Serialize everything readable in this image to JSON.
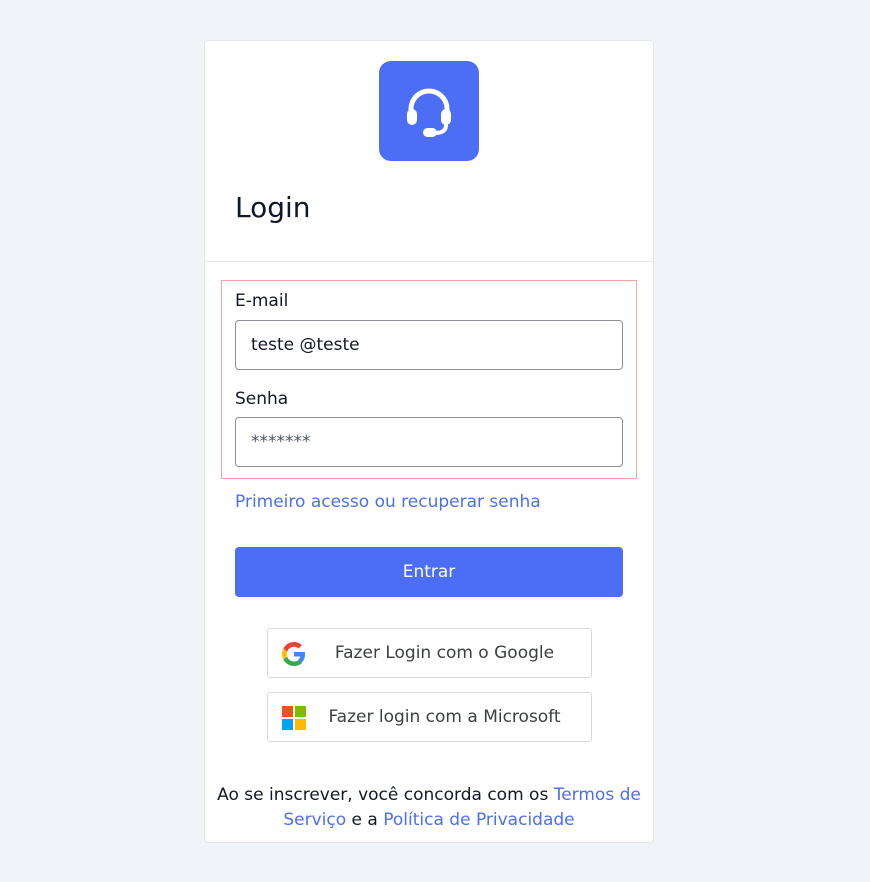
{
  "login": {
    "title": "Login",
    "email_label": "E-mail",
    "email_value": "teste @teste",
    "password_label": "Senha",
    "password_placeholder": "*******",
    "recover_link": "Primeiro acesso ou recuperar senha",
    "submit_label": "Entrar",
    "google_label": "Fazer Login com o Google",
    "microsoft_label": "Fazer login com a Microsoft"
  },
  "terms": {
    "prefix": "Ao se inscrever, você concorda com os ",
    "terms_link": "Termos de Serviço",
    "middle": " e a ",
    "privacy_link": "Política de Privacidade"
  },
  "icons": {
    "logo": "headset-icon",
    "google": "google-icon",
    "microsoft": "microsoft-icon"
  },
  "colors": {
    "accent": "#4c6ef5",
    "background": "#f0f3f8",
    "highlight_border": "#f2a3a3"
  }
}
